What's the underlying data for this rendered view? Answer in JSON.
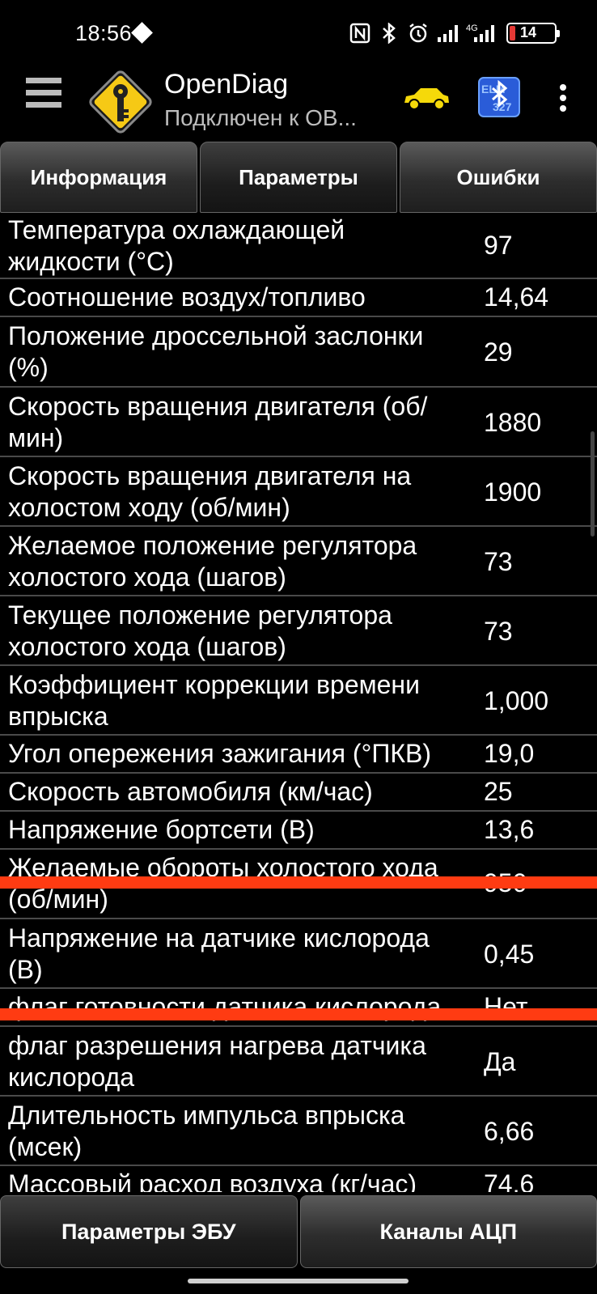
{
  "status_bar": {
    "time": "18:56",
    "network": "4G",
    "battery": "14",
    "battery_color": "#e53935"
  },
  "toolbar": {
    "app_title": "OpenDiag",
    "subtitle": "Подключен к ОВ...",
    "car_icon_color": "#f5d90a"
  },
  "tabs": [
    {
      "label": "Информация"
    },
    {
      "label": "Параметры"
    },
    {
      "label": "Ошибки"
    }
  ],
  "parameters": [
    {
      "label": "Температура охлаждающей\nжидкости (°С)",
      "value": "97"
    },
    {
      "label": "Соотношение воздух/топливо",
      "value": "14,64"
    },
    {
      "label": "Положение дроссельной заслонки\n(%)",
      "value": "29"
    },
    {
      "label": "Скорость вращения двигателя (об/\nмин)",
      "value": "1880"
    },
    {
      "label": "Скорость вращения двигателя на\nхолостом ходу (об/мин)",
      "value": "1900"
    },
    {
      "label": "Желаемое положение регулятора\nхолостого хода (шагов)",
      "value": "73"
    },
    {
      "label": "Текущее положение регулятора\nхолостого хода (шагов)",
      "value": "73"
    },
    {
      "label": "Коэффициент коррекции времени\nвпрыска",
      "value": "1,000"
    },
    {
      "label": "Угол опережения зажигания (°ПКВ)",
      "value": "19,0"
    },
    {
      "label": "Скорость автомобиля (км/час)",
      "value": "25"
    },
    {
      "label": "Напряжение бортсети (В)",
      "value": "13,6"
    },
    {
      "label": "Желаемые обороты холостого хода\n(об/мин)",
      "value": "950"
    },
    {
      "label": "Напряжение на датчике кислорода\n(В)",
      "value": "0,45"
    },
    {
      "label": "флаг готовности датчика кислорода",
      "value": "Нет"
    },
    {
      "label": "флаг разрешения нагрева датчика\nкислорода",
      "value": "Да"
    },
    {
      "label": "Длительность импульса впрыска\n(мсек)",
      "value": "6,66"
    },
    {
      "label": "Массовый расход воздуха (кг/час)",
      "value": "74,6"
    }
  ],
  "bottom_buttons": [
    {
      "label": "Параметры ЭБУ"
    },
    {
      "label": "Каналы АЦП"
    }
  ],
  "overlay_color": "#ff3b12"
}
